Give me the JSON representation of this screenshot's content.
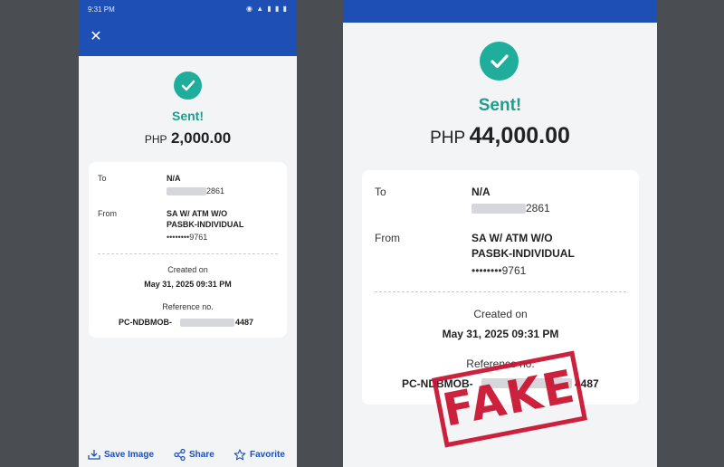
{
  "left": {
    "status": {
      "time": "9:31 PM",
      "icons": "◉ ▲ ▮ ▮ ▮"
    },
    "close": "✕",
    "sent": "Sent!",
    "currency": "PHP",
    "amount": "2,000.00",
    "to_label": "To",
    "to_name": "N/A",
    "to_account_tail": "2861",
    "from_label": "From",
    "from_line1": "SA W/ ATM W/O",
    "from_line2": "PASBK-INDIVIDUAL",
    "from_account": "••••••••9761",
    "created_label": "Created on",
    "created_value": "May 31, 2025 09:31 PM",
    "ref_label": "Reference no.",
    "ref_prefix": "PC-NDBMOB-",
    "ref_suffix": "4487",
    "footer": {
      "save": "Save Image",
      "share": "Share",
      "favorite": "Favorite"
    }
  },
  "right": {
    "sent": "Sent!",
    "currency": "PHP",
    "amount": "44,000.00",
    "to_label": "To",
    "to_name": "N/A",
    "to_account_tail": "2861",
    "from_label": "From",
    "from_line1": "SA W/ ATM W/O",
    "from_line2": "PASBK-INDIVIDUAL",
    "from_account": "••••••••9761",
    "created_label": "Created on",
    "created_value": "May 31, 2025 09:31 PM",
    "ref_label": "Reference no.",
    "ref_prefix": "PC-NDBMOB-",
    "ref_suffix": "4487",
    "stamp": "FAKE"
  },
  "colors": {
    "brand_blue": "#1e4fb5",
    "success_teal": "#1fae9b",
    "stamp_red": "#c8102e"
  }
}
